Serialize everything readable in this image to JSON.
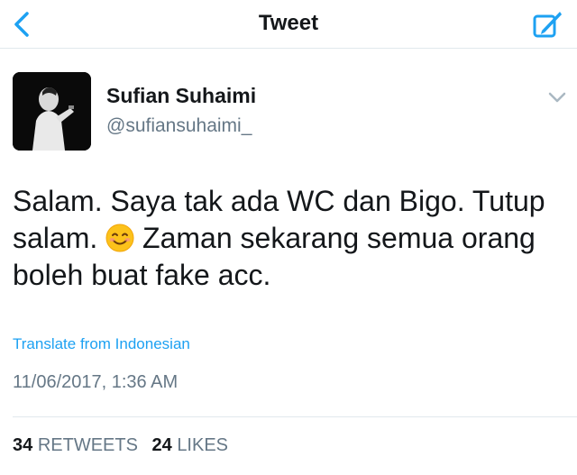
{
  "nav": {
    "title": "Tweet",
    "back_icon": "chevron-left-icon",
    "compose_icon": "compose-tweet-icon",
    "accent_color": "#1da1f2"
  },
  "author": {
    "name": "Sufian Suhaimi",
    "handle": "@sufiansuhaimi_"
  },
  "tweet": {
    "text_part1": "Salam. Saya tak ada WC dan Bigo. Tutup salam.",
    "emoji": "smiling-face-emoji",
    "text_part2": "Zaman sekarang semua orang boleh buat fake acc.",
    "translate_label": "Translate from Indonesian",
    "timestamp": "11/06/2017, 1:36 AM"
  },
  "stats": {
    "retweets_count": "34",
    "retweets_label": "RETWEETS",
    "likes_count": "24",
    "likes_label": "LIKES"
  }
}
